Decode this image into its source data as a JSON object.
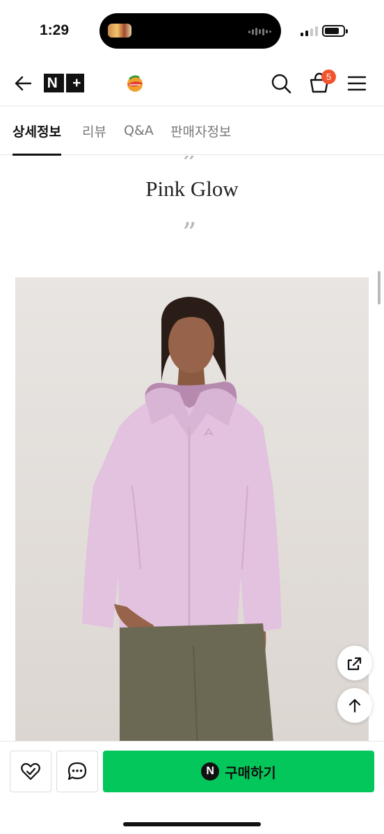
{
  "status_bar": {
    "time": "1:29",
    "battery_level": 0.8,
    "signal_bars_active": 2,
    "signal_bars_total": 4
  },
  "header": {
    "logo_text": "N+",
    "cart_count": "5",
    "accent_color": "#f1542c"
  },
  "tabs": [
    {
      "label": "상세정보",
      "active": true
    },
    {
      "label": "리뷰",
      "active": false
    },
    {
      "label": "Q&A",
      "active": false
    },
    {
      "label": "판매자정보",
      "active": false
    }
  ],
  "content": {
    "quote_open": "”",
    "color_title": "Pink Glow",
    "quote_close": "”",
    "jacket_color": "#e2c2df",
    "pants_color": "#6b6853"
  },
  "bottom_bar": {
    "buy_badge": "N",
    "buy_label": "구매하기",
    "buy_color": "#03c75a"
  }
}
